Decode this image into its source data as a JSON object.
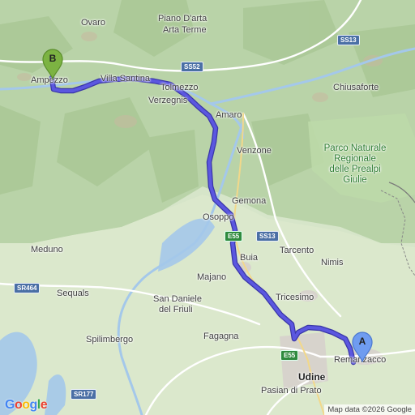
{
  "map": {
    "attribution": "Map data ©2026 Google",
    "logo_text": "Google",
    "logo_colors": [
      "#4285f4",
      "#ea4335",
      "#fbbc05",
      "#4285f4",
      "#34a853",
      "#ea4335"
    ],
    "route_color": "#5b57e0",
    "route_outline_color": "#3a36a8"
  },
  "markers": {
    "start": {
      "label": "A",
      "color": "#6f9cf0",
      "stroke": "#4a78d0"
    },
    "end": {
      "label": "B",
      "color": "#7cb342",
      "stroke": "#5a8e2a"
    }
  },
  "places": {
    "ovaro": "Ovaro",
    "piano_darta": "Piano D'arta",
    "arta_terme": "Arta Terme",
    "ampezzo": "Ampezzo",
    "villa_santina": "Villa Santina",
    "tolmezzo": "Tolmezzo",
    "verzegnis": "Verzegnis",
    "amaro": "Amaro",
    "chiusaforte": "Chiusaforte",
    "venzone": "Venzone",
    "gemona": "Gemona",
    "osoppo": "Osoppo",
    "buia": "Buia",
    "tarcento": "Tarcento",
    "nimis": "Nimis",
    "majano": "Majano",
    "meduno": "Meduno",
    "sequals": "Sequals",
    "san_daniele_1": "San Daniele",
    "san_daniele_2": "del Friuli",
    "tricesimo": "Tricesimo",
    "spilimbergo": "Spilimbergo",
    "fagagna": "Fagagna",
    "remanzacco": "Remanzacco",
    "udine": "Udine",
    "pasian_di_prato": "Pasian di Prato"
  },
  "park": {
    "line1": "Parco Naturale",
    "line2": "Regionale",
    "line3": "delle Prealpi",
    "line4": "Giulie"
  },
  "road_shields": {
    "ss13_top": "SS13",
    "ss52": "SS52",
    "e55_osoppo": "E55",
    "ss13_mid": "SS13",
    "sr464": "SR464",
    "e55_udine": "E55",
    "sr177": "SR177"
  }
}
